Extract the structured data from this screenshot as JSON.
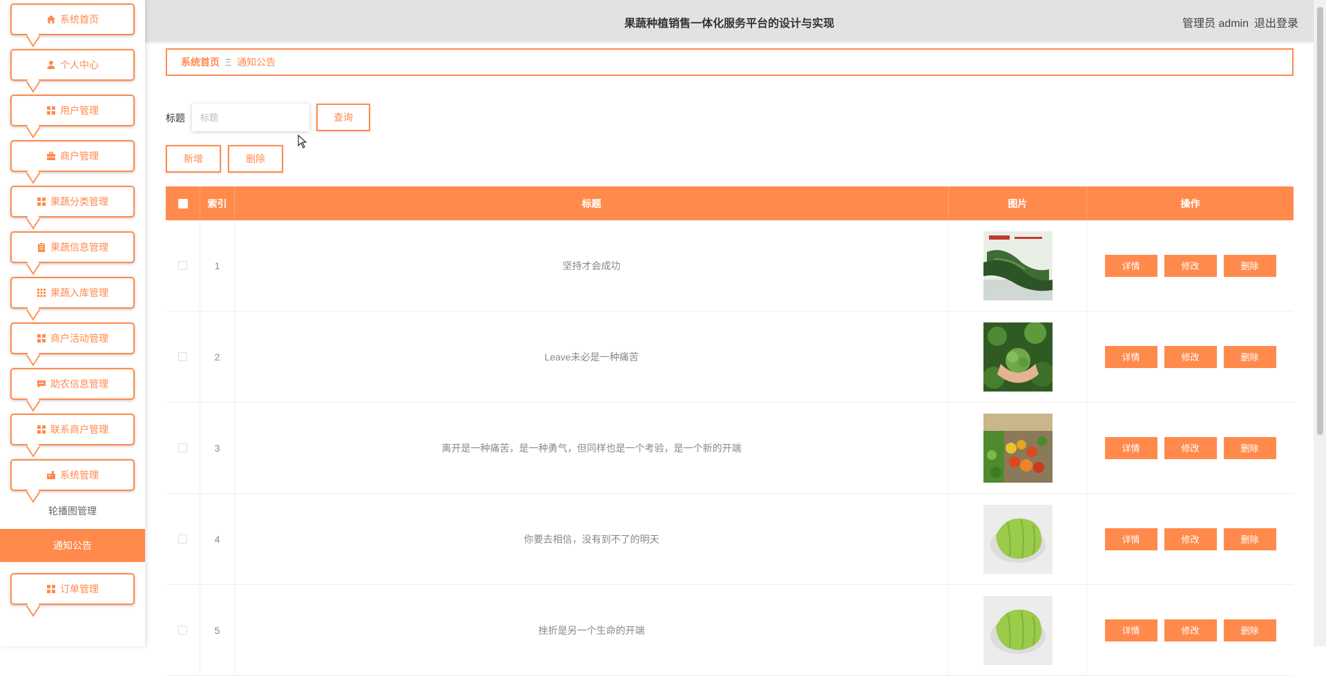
{
  "sidebar": {
    "items": [
      {
        "label": "系统首页",
        "icon": "home-icon"
      },
      {
        "label": "个人中心",
        "icon": "user-icon"
      },
      {
        "label": "用户管理",
        "icon": "grid-icon"
      },
      {
        "label": "商户管理",
        "icon": "briefcase-icon"
      },
      {
        "label": "果蔬分类管理",
        "icon": "grid-icon"
      },
      {
        "label": "果蔬信息管理",
        "icon": "clipboard-icon"
      },
      {
        "label": "果蔬入库管理",
        "icon": "apps-icon"
      },
      {
        "label": "商户活动管理",
        "icon": "grid-icon"
      },
      {
        "label": "助农信息管理",
        "icon": "message-icon"
      },
      {
        "label": "联系商户管理",
        "icon": "grid-icon"
      },
      {
        "label": "系统管理",
        "icon": "settings-icon"
      }
    ],
    "sub_items": [
      {
        "label": "轮播图管理"
      },
      {
        "label": "通知公告"
      }
    ],
    "last_item": {
      "label": "订单管理",
      "icon": "grid-icon"
    }
  },
  "header": {
    "title": "果蔬种植销售一体化服务平台的设计与实现",
    "user": "管理员 admin",
    "logout": "退出登录"
  },
  "breadcrumb": {
    "home": "系统首页",
    "separator": "Ξ",
    "current": "通知公告"
  },
  "search": {
    "label": "标题",
    "placeholder": "标题",
    "value": "",
    "button": "查询"
  },
  "actions": {
    "add": "新增",
    "delete": "删除"
  },
  "table": {
    "headers": {
      "index": "索引",
      "title": "标题",
      "image": "图片",
      "ops": "操作"
    },
    "rows": [
      {
        "index": "1",
        "title": "坚持才会成功",
        "image": "green-vegetables-image"
      },
      {
        "index": "2",
        "title": "Leave未必是一种痛苦",
        "image": "hands-holding-greens-image"
      },
      {
        "index": "3",
        "title": "离开是一种痛苦，是一种勇气，但同样也是一个考验，是一个新的开端",
        "image": "produce-market-image"
      },
      {
        "index": "4",
        "title": "你要去相信，没有到不了的明天",
        "image": "chayote-image"
      },
      {
        "index": "5",
        "title": "挫折是另一个生命的开端",
        "image": "chayote-image"
      }
    ],
    "ops": {
      "detail": "详情",
      "edit": "修改",
      "delete": "删除"
    }
  },
  "colors": {
    "accent": "#ff8a4c",
    "header_bg": "#e2e2e2"
  }
}
